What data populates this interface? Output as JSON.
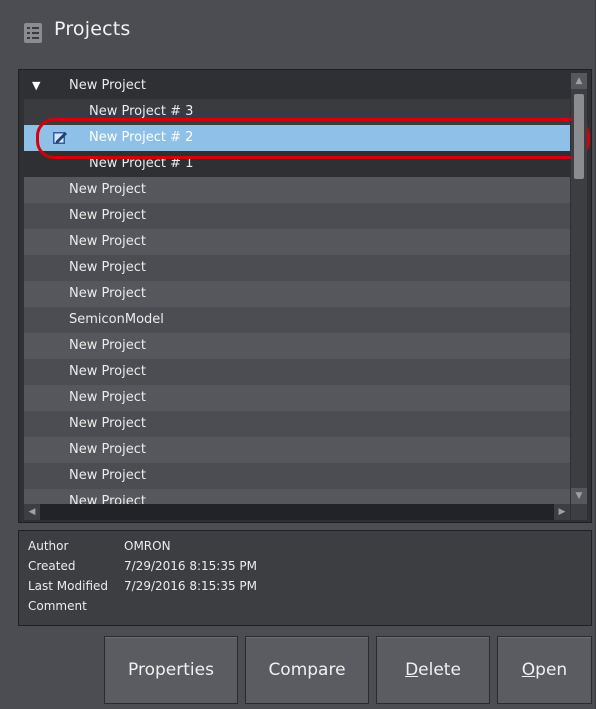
{
  "window": {
    "title": "Projects"
  },
  "tree": {
    "rows": [
      {
        "label": "New Project",
        "expanded": true
      },
      {
        "label": "New Project # 3"
      },
      {
        "label": "New Project # 2",
        "selected": true
      },
      {
        "label": "New Project # 1"
      },
      {
        "label": "New Project"
      },
      {
        "label": "New Project"
      },
      {
        "label": "New Project"
      },
      {
        "label": "New Project"
      },
      {
        "label": "New Project"
      },
      {
        "label": "SemiconModel"
      },
      {
        "label": "New Project"
      },
      {
        "label": "New Project"
      },
      {
        "label": "New Project"
      },
      {
        "label": "New Project"
      },
      {
        "label": "New Project"
      },
      {
        "label": "New Project"
      },
      {
        "label": "New Project"
      }
    ]
  },
  "info": {
    "author_label": "Author",
    "author_value": "OMRON",
    "created_label": "Created",
    "created_value": "7/29/2016 8:15:35 PM",
    "modified_label": "Last Modified",
    "modified_value": "7/29/2016 8:15:35 PM",
    "comment_label": "Comment",
    "comment_value": ""
  },
  "buttons": {
    "properties": "Properties",
    "compare": "Compare",
    "delete_mnemonic": "D",
    "delete_rest": "elete",
    "open_mnemonic": "O",
    "open_rest": "pen"
  },
  "colors": {
    "selection": "#8fc1e8",
    "annotation_ring": "#d4000c",
    "background": "#4b4d52"
  }
}
